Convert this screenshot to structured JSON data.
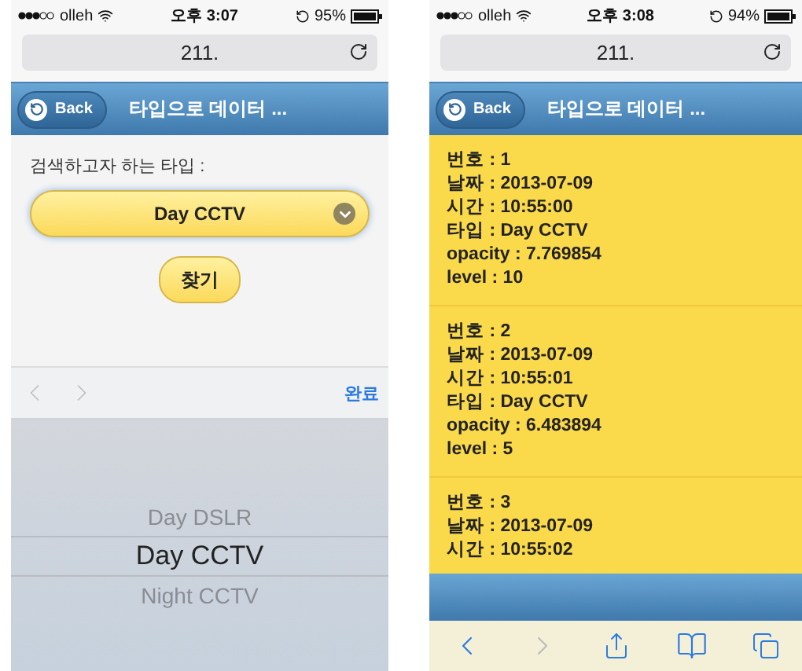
{
  "screens": [
    {
      "kind": "search",
      "status": {
        "carrier": "olleh",
        "time": "오후 3:07",
        "battery": "95%"
      },
      "url": "211.",
      "header": {
        "back": "Back",
        "title": "타입으로 데이터 ..."
      },
      "form": {
        "label": "검색하고자 하는 타입 :",
        "select_value": "Day CCTV",
        "submit": "찾기"
      },
      "keyboard_toolbar": {
        "done": "완료"
      },
      "picker": [
        {
          "label": "Day DSLR",
          "selected": false
        },
        {
          "label": "Day CCTV",
          "selected": true
        },
        {
          "label": "Night CCTV",
          "selected": false
        }
      ]
    },
    {
      "kind": "results",
      "status": {
        "carrier": "olleh",
        "time": "오후 3:08",
        "battery": "94%"
      },
      "url": "211.",
      "header": {
        "back": "Back",
        "title": "타입으로 데이터 ..."
      },
      "records": [
        {
          "lines": [
            "번호 : 1",
            "날짜 : 2013-07-09",
            "시간 : 10:55:00",
            "타입 : Day CCTV",
            "opacity : 7.769854",
            "level : 10"
          ]
        },
        {
          "lines": [
            "번호 : 2",
            "날짜 : 2013-07-09",
            "시간 : 10:55:01",
            "타입 : Day CCTV",
            "opacity : 6.483894",
            "level : 5"
          ]
        },
        {
          "lines": [
            "번호 : 3",
            "날짜 : 2013-07-09",
            "시간 : 10:55:02"
          ]
        }
      ]
    }
  ]
}
